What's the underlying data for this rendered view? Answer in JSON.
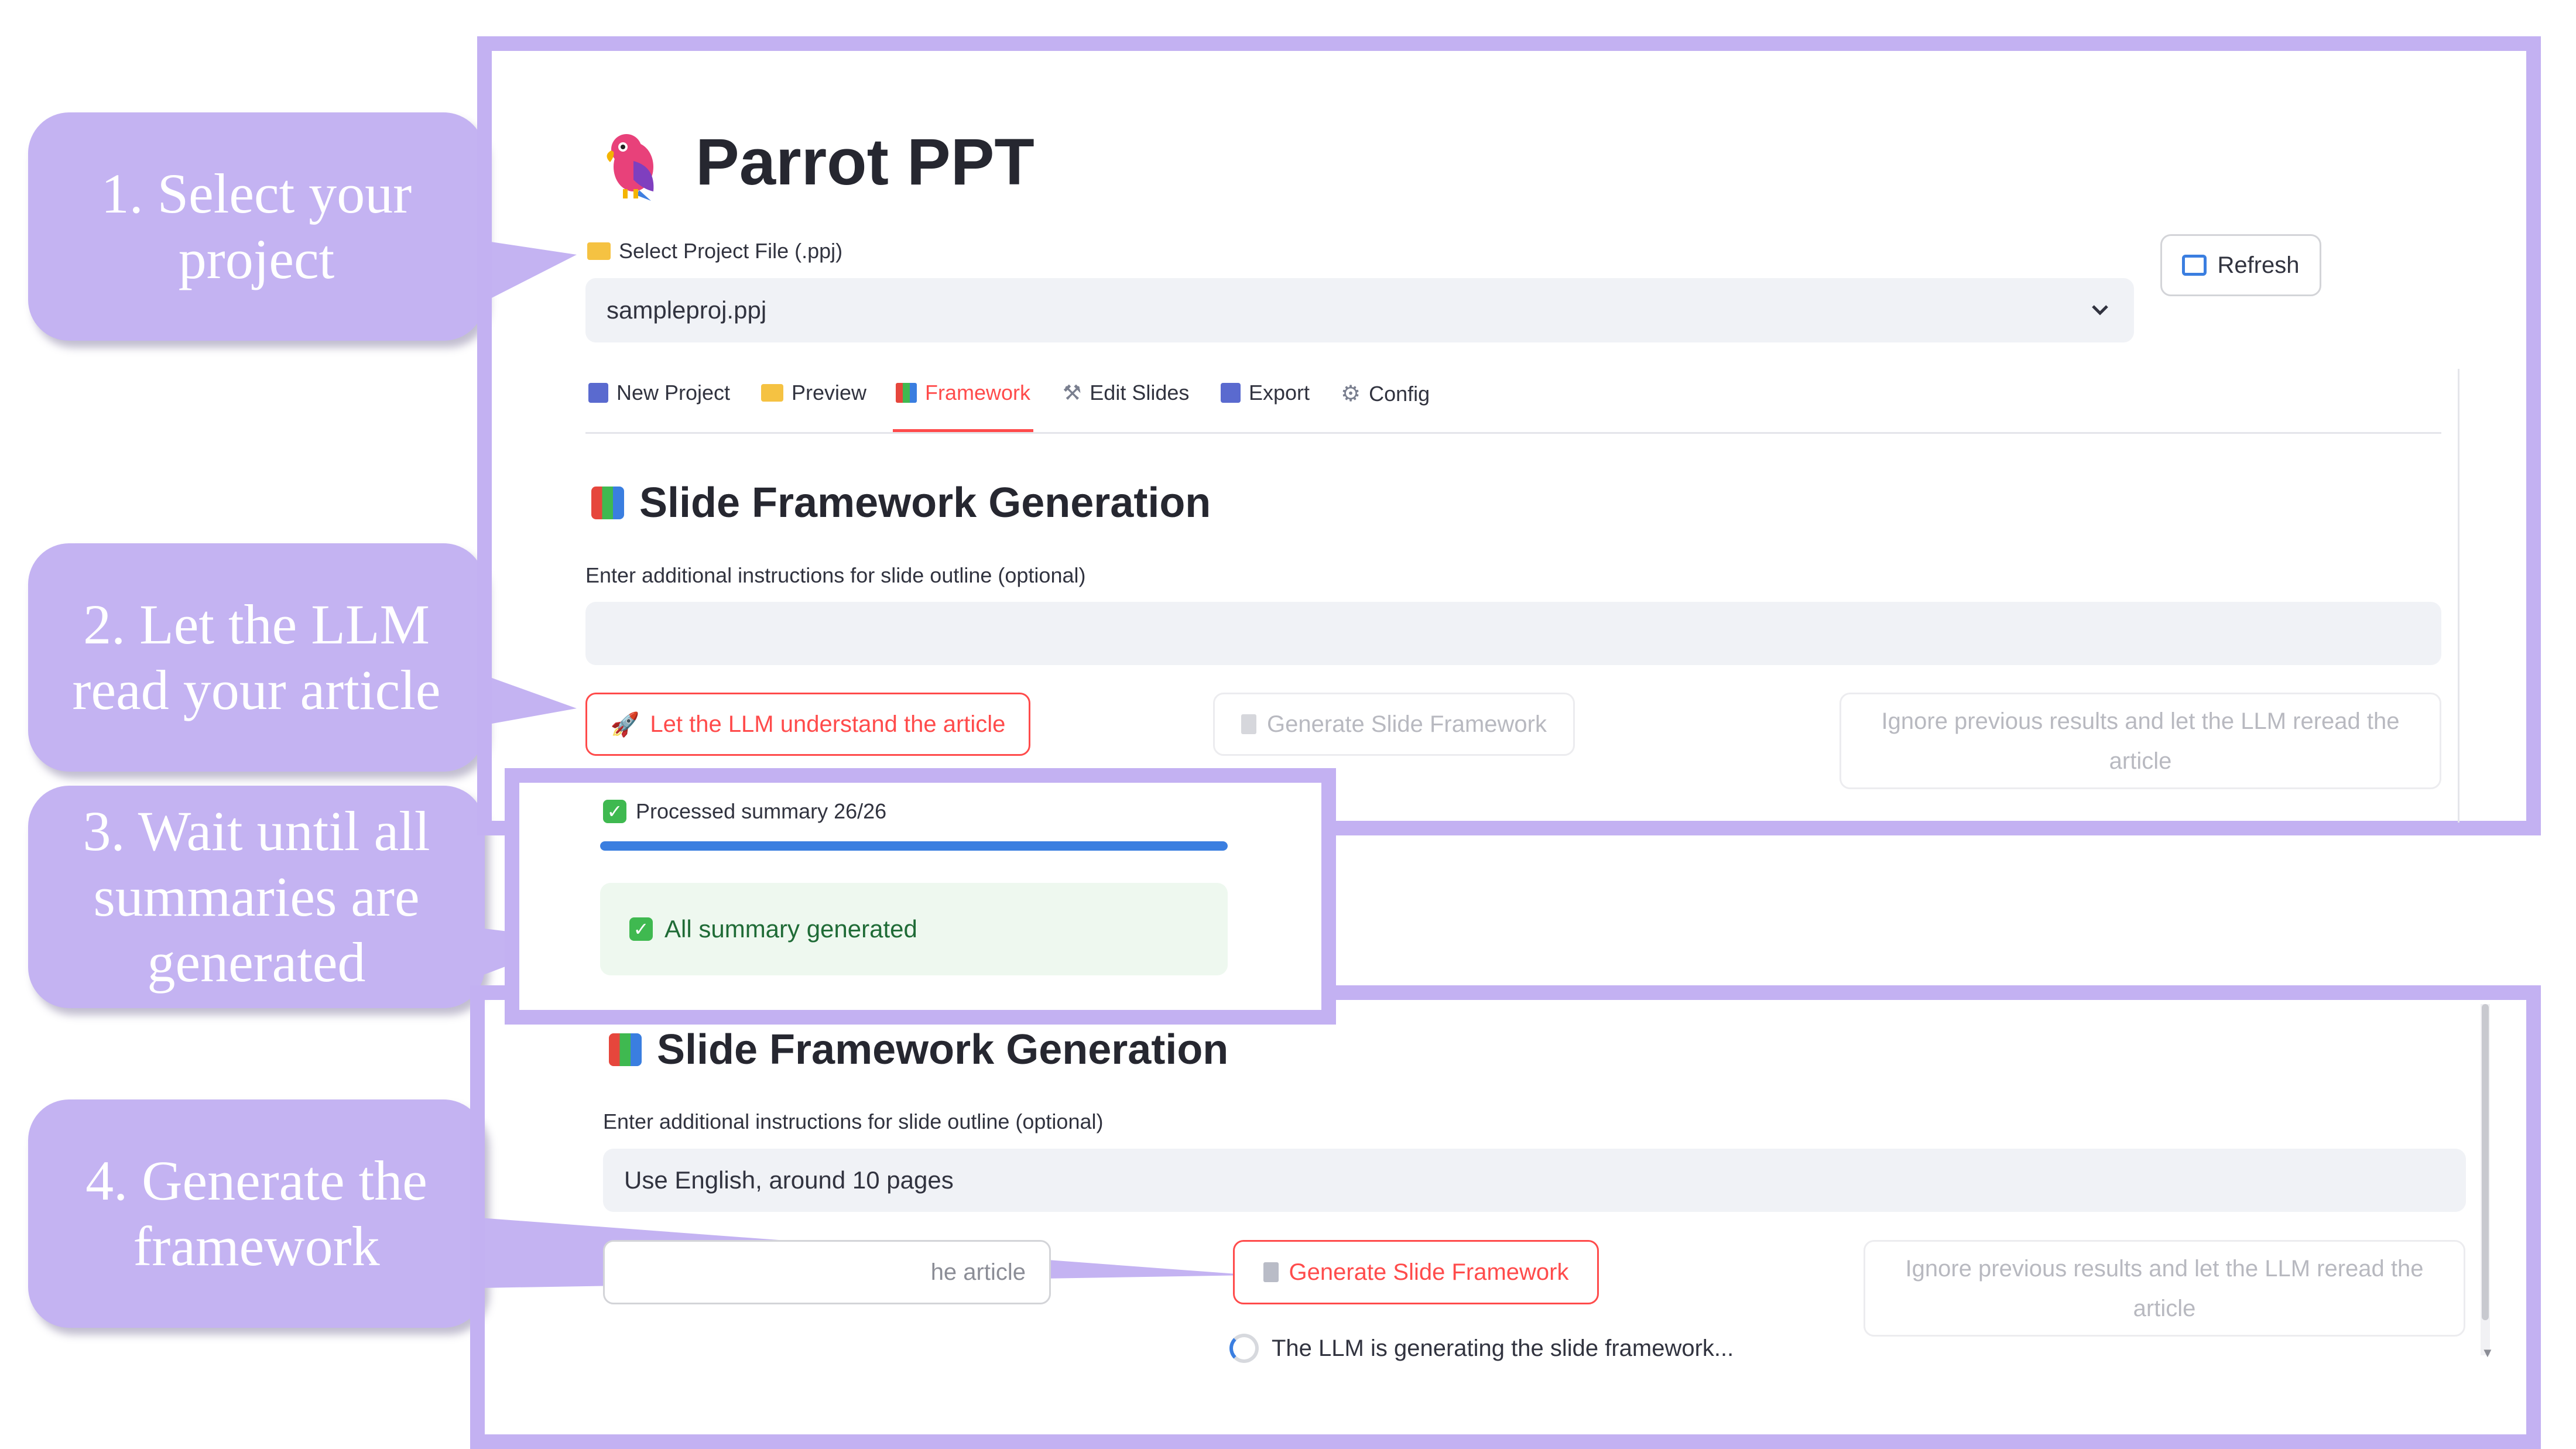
{
  "callouts": [
    "1. Select your project",
    "2. Let the LLM read your article",
    "3. Wait until all summaries are generated",
    "4. Generate the framework"
  ],
  "app": {
    "title": "Parrot PPT",
    "logo_icon": "parrot-icon"
  },
  "project": {
    "label": "Select Project File (.ppj)",
    "selected": "sampleproj.ppj",
    "refresh_label": "Refresh"
  },
  "tabs": [
    {
      "label": "New Project",
      "icon": "inbox-icon"
    },
    {
      "label": "Preview",
      "icon": "folder-icon"
    },
    {
      "label": "Framework",
      "icon": "books-icon",
      "active": true
    },
    {
      "label": "Edit Slides",
      "icon": "tools-icon"
    },
    {
      "label": "Export",
      "icon": "outbox-icon"
    },
    {
      "label": "Config",
      "icon": "gear-icon"
    }
  ],
  "framework": {
    "heading": "Slide Framework Generation",
    "instructions_label": "Enter additional instructions for slide outline (optional)",
    "instructions_value_top": "",
    "instructions_value_bottom": "Use English, around 10 pages",
    "understand_button": "Let the LLM understand the article",
    "generate_button": "Generate Slide Framework",
    "reread_button": "Ignore previous results and let the LLM reread the article",
    "bottom_left_button_fragment": "he article",
    "spinner_text": "The LLM is generating the slide framework..."
  },
  "progress": {
    "label": "Processed summary 26/26",
    "fraction": 1.0,
    "success_text": "All summary generated"
  },
  "colors": {
    "accent": "#ff4b4b",
    "annotation": "#c4b3f2",
    "progress": "#3a7ee0",
    "success_bg": "#eef8ef",
    "success_text": "#1f6b36"
  }
}
